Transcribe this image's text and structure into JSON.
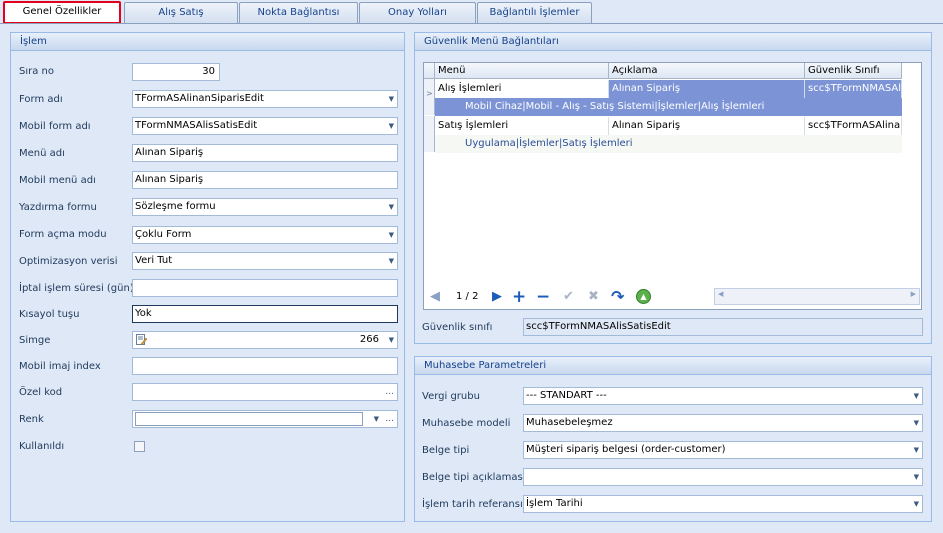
{
  "tabs": [
    {
      "label": "Genel Özellikler",
      "active": true
    },
    {
      "label": "Alış Satış"
    },
    {
      "label": "Nokta Bağlantısı"
    },
    {
      "label": "Onay Yolları"
    },
    {
      "label": "Bağlantılı İşlemler"
    }
  ],
  "islem": {
    "title": "İşlem",
    "sira_no": {
      "label": "Sıra no",
      "value": "30"
    },
    "form_adi": {
      "label": "Form adı",
      "value": "TFormASAlinanSiparisEdit"
    },
    "mobil_form_adi": {
      "label": "Mobil form adı",
      "value": "TFormNMASAlisSatisEdit"
    },
    "menu_adi": {
      "label": "Menü adı",
      "value": "Alınan Sipariş"
    },
    "mobil_menu_adi": {
      "label": "Mobil menü adı",
      "value": "Alınan Sipariş"
    },
    "yazdirma_formu": {
      "label": "Yazdırma formu",
      "value": "Sözleşme formu"
    },
    "form_acma_modu": {
      "label": "Form açma modu",
      "value": "Çoklu Form"
    },
    "optimizasyon": {
      "label": "Optimizasyon verisi",
      "value": "Veri Tut"
    },
    "iptal_suresi": {
      "label": "İptal işlem süresi (gün)",
      "value": ""
    },
    "kisayol": {
      "label": "Kısayol tuşu",
      "value": "Yok"
    },
    "simge": {
      "label": "Simge",
      "value": "266"
    },
    "mobil_imaj": {
      "label": "Mobil imaj index",
      "value": ""
    },
    "ozel_kod": {
      "label": "Özel kod",
      "value": "",
      "ellipsis": "..."
    },
    "renk": {
      "label": "Renk",
      "value": "",
      "ellipsis": "..."
    },
    "kullanildi": {
      "label": "Kullanıldı",
      "checked": false
    }
  },
  "guvenlik": {
    "title": "Güvenlik Menü Bağlantıları",
    "columns": [
      "Menü",
      "Açıklama",
      "Güvenlik Sınıfı"
    ],
    "rows": [
      {
        "menu": "Alış İşlemleri",
        "aciklama": "Alınan Sipariş",
        "sinif": "scc$TFormNMASAlis",
        "detail": "Mobil Cihaz|Mobil - Alış - Satış Sistemi|İşlemler|Alış İşlemleri",
        "selected": true
      },
      {
        "menu": "Satış İşlemleri",
        "aciklama": "Alınan Sipariş",
        "sinif": "scc$TFormASAlinan",
        "detail": "Uygulama|İşlemler|Satış İşlemleri",
        "selected": false
      }
    ],
    "pager": "1 / 2",
    "sinif_label": "Güvenlik sınıfı",
    "sinif_value": "scc$TFormNMASAlisSatisEdit"
  },
  "muhasebe": {
    "title": "Muhasebe Parametreleri",
    "vergi_grubu": {
      "label": "Vergi grubu",
      "value": "--- STANDART ---"
    },
    "muhasebe_modeli": {
      "label": "Muhasebe modeli",
      "value": "Muhasebeleşmez"
    },
    "belge_tipi": {
      "label": "Belge tipi",
      "value": "Müşteri sipariş belgesi (order-customer)"
    },
    "belge_tipi_aciklama": {
      "label": "Belge tipi açıklaması",
      "value": ""
    },
    "islem_tarih": {
      "label": "İşlem tarih referansı",
      "value": "İşlem Tarihi"
    }
  },
  "icons": {
    "dropdown": "▼",
    "nav_prev": "◀",
    "nav_next": "▶",
    "add": "+",
    "remove": "−",
    "check": "✔",
    "cancel": "✖",
    "refresh": "↷",
    "up": "▲"
  }
}
